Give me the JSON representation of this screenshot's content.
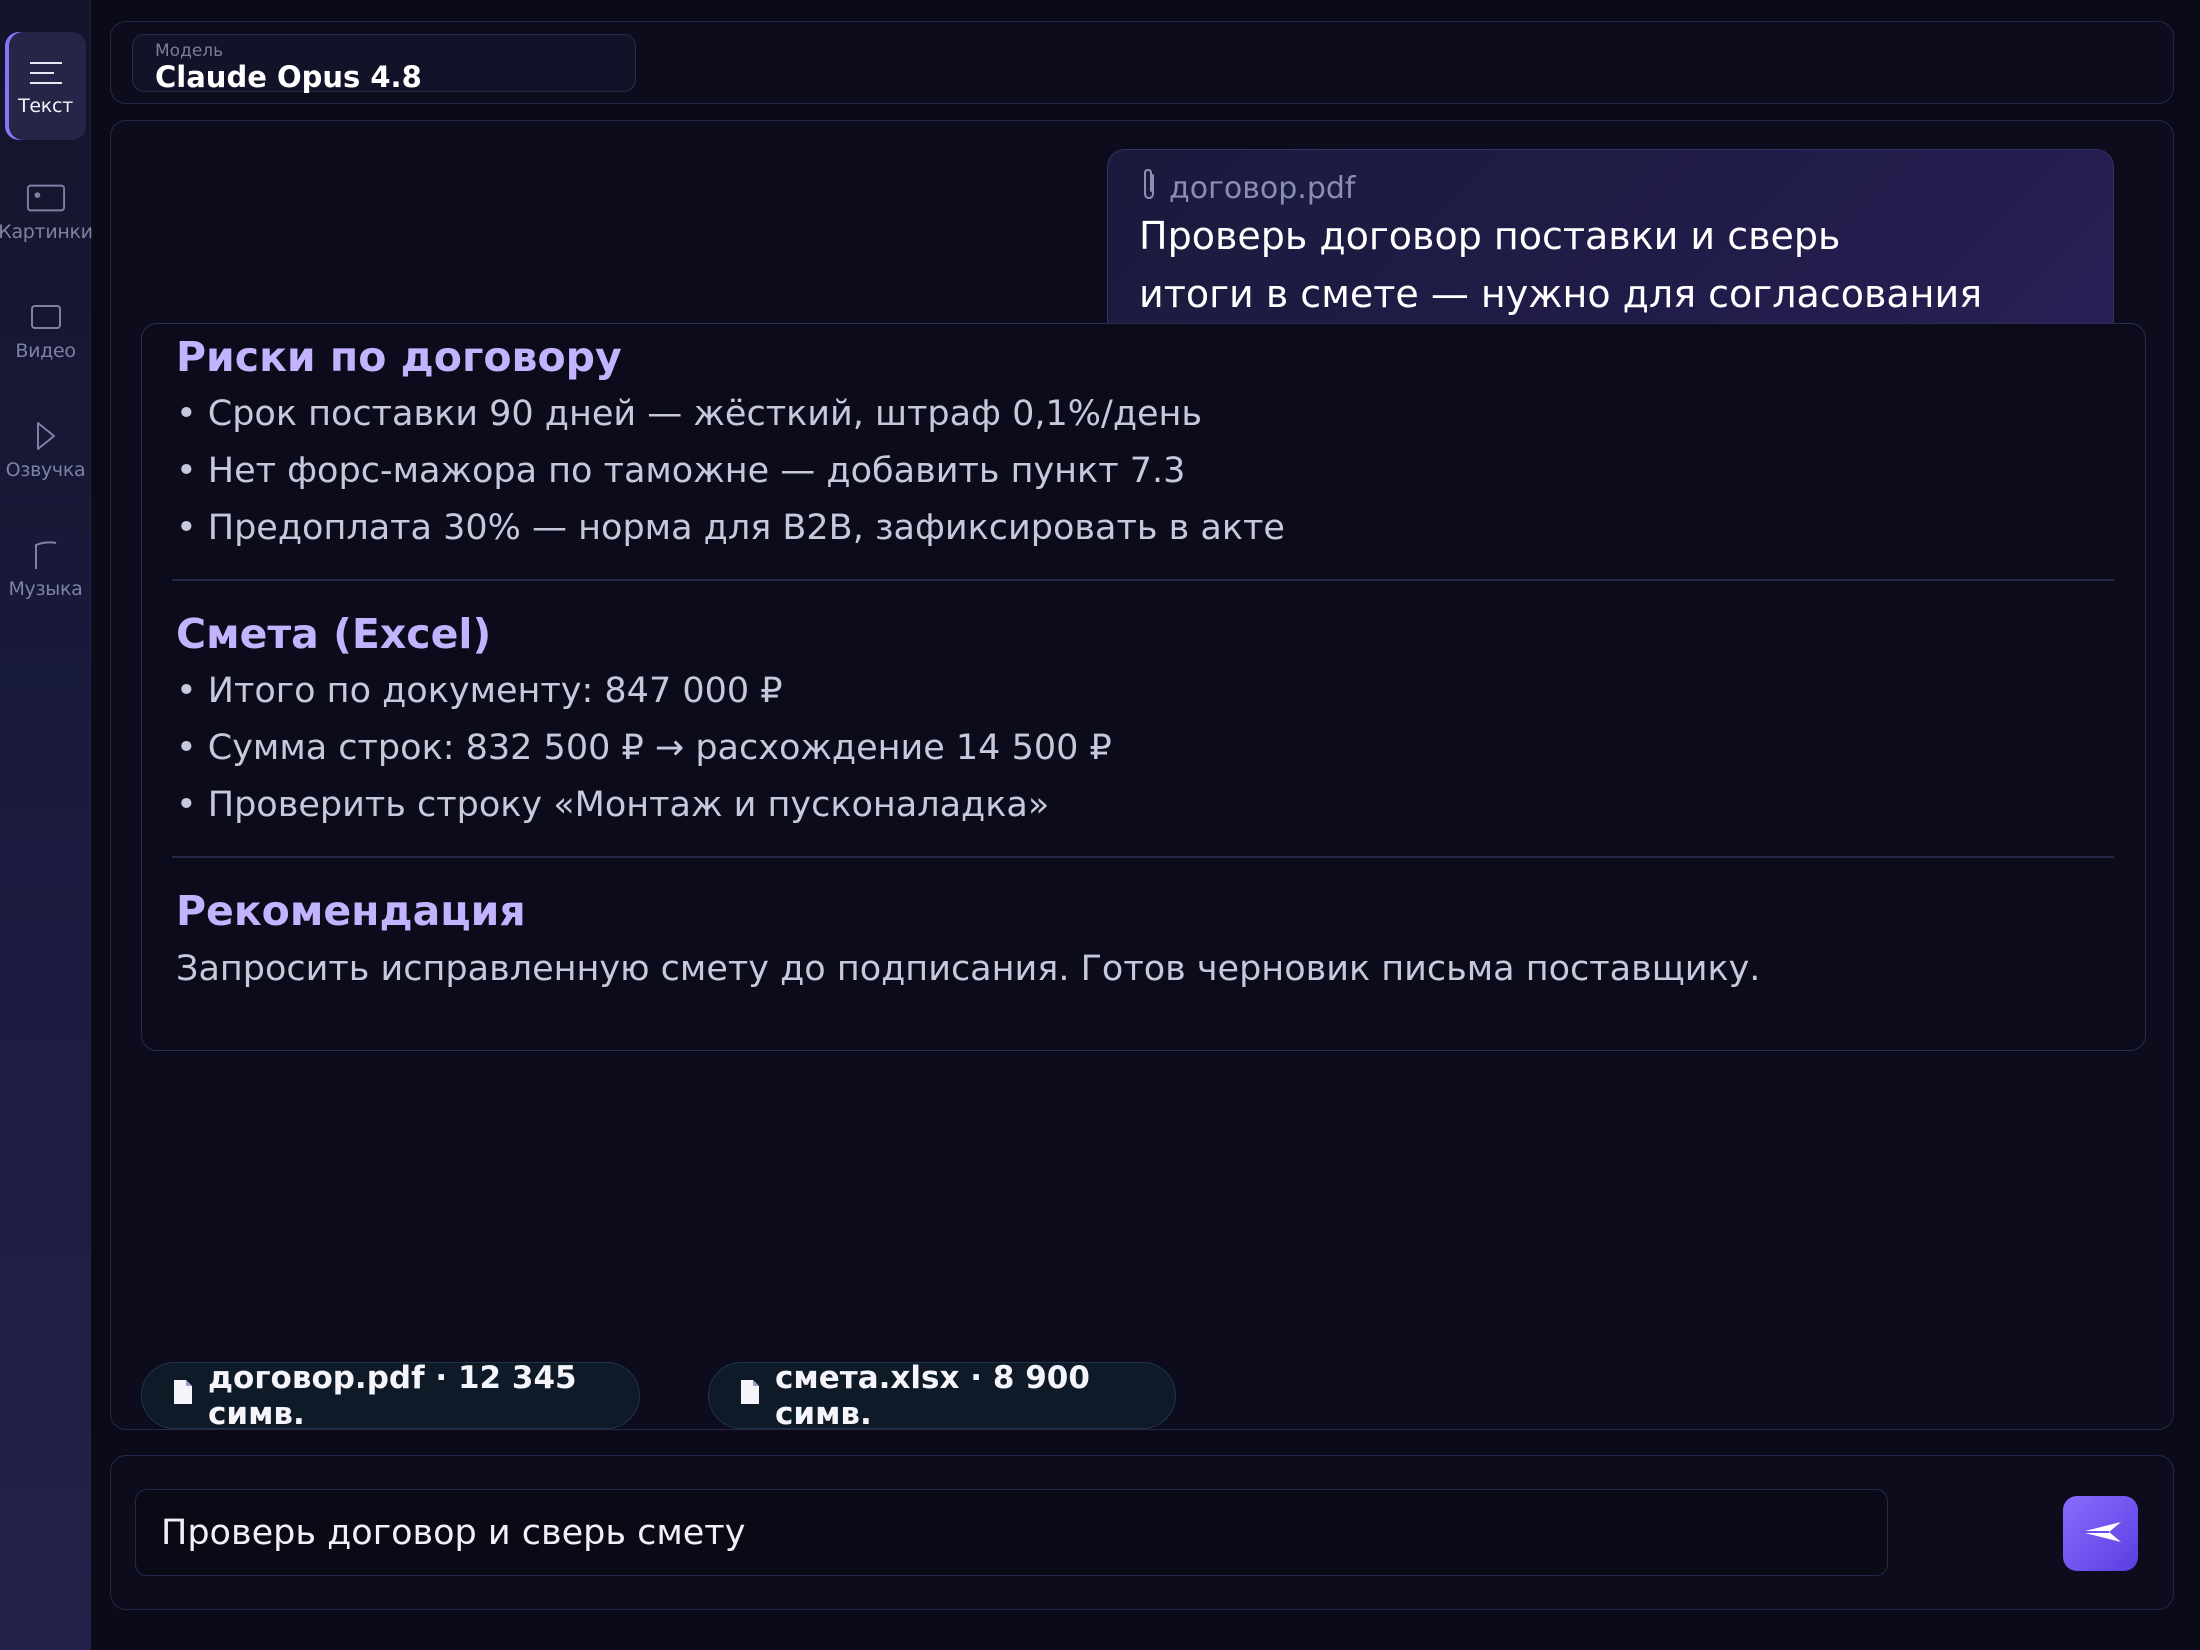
{
  "sidebar": {
    "items": [
      {
        "label": "Текст",
        "icon": "text-lines-icon",
        "active": true
      },
      {
        "label": "Картинки",
        "icon": "image-icon",
        "active": false
      },
      {
        "label": "Видео",
        "icon": "video-icon",
        "active": false
      },
      {
        "label": "Озвучка",
        "icon": "play-icon",
        "active": false
      },
      {
        "label": "Музыка",
        "icon": "music-flag-icon",
        "active": false
      }
    ]
  },
  "model": {
    "caption": "Модель",
    "name": "Claude Opus 4.8"
  },
  "chat": {
    "user_message": {
      "attachment": "договор.pdf",
      "line1": "Проверь договор поставки и сверь",
      "line2": "итоги в смете — нужно для согласования"
    },
    "answer": {
      "sections": [
        {
          "title": "Риски по договору",
          "bullets": [
            "• Срок поставки 90 дней — жёсткий, штраф 0,1%/день",
            "• Нет форс-мажора по таможне — добавить пункт 7.3",
            "• Предоплата 30% — норма для B2B, зафиксировать в акте"
          ]
        },
        {
          "title": "Смета (Excel)",
          "bullets": [
            "• Итого по документу: 847 000 ₽",
            "• Сумма строк: 832 500 ₽ → расхождение 14 500 ₽",
            "• Проверить строку «Монтаж и пусконаладка»"
          ]
        },
        {
          "title": "Рекомендация",
          "text": "Запросить исправленную смету до подписания. Готов черновик письма поставщику."
        }
      ]
    },
    "files": [
      {
        "label": "договор.pdf · 12 345 симв."
      },
      {
        "label": "смета.xlsx · 8 900 симв."
      }
    ]
  },
  "composer": {
    "value": "Проверь договор и сверь смету"
  },
  "colors": {
    "accent": "#8b6cff",
    "heading": "#c3b3ff",
    "background": "#0a0a18"
  }
}
